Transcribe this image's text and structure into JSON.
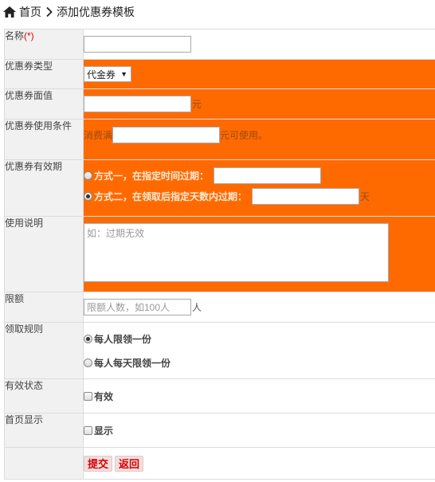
{
  "breadcrumb": {
    "home": "首页",
    "current": "添加优惠券模板"
  },
  "form": {
    "name": {
      "label": "名称",
      "required_mark": "(*)",
      "value": ""
    },
    "type": {
      "label": "优惠券类型",
      "selected": "代金券"
    },
    "face_value": {
      "label": "优惠券面值",
      "value": "",
      "unit": "元"
    },
    "condition": {
      "label": "优惠券使用条件",
      "prefix": "消费满",
      "value": "",
      "suffix": "元可使用。"
    },
    "validity": {
      "label": "优惠券有效期",
      "option1": {
        "label": "方式一，在指定时间过期：",
        "value": "",
        "checked": false
      },
      "option2": {
        "label": "方式二，在领取后指定天数内过期：",
        "value": "",
        "unit": "天",
        "checked": true
      }
    },
    "description": {
      "label": "使用说明",
      "placeholder": "如：过期无效",
      "value": ""
    },
    "limit": {
      "label": "限额",
      "placeholder": "限额人数，如100人",
      "unit": "人"
    },
    "claim_rule": {
      "label": "领取规则",
      "options": [
        {
          "label": "每人限领一份",
          "checked": true
        },
        {
          "label": "每人每天限领一份",
          "checked": false
        }
      ]
    },
    "status": {
      "label": "有效状态",
      "checkbox_label": "有效",
      "checked": false
    },
    "homepage": {
      "label": "首页显示",
      "checkbox_label": "显示",
      "checked": false
    }
  },
  "actions": {
    "submit": "提交",
    "back": "返回"
  },
  "colors": {
    "highlight": "#ff6a00",
    "label_bg": "#f1f1f1",
    "button_text": "#d40000"
  }
}
